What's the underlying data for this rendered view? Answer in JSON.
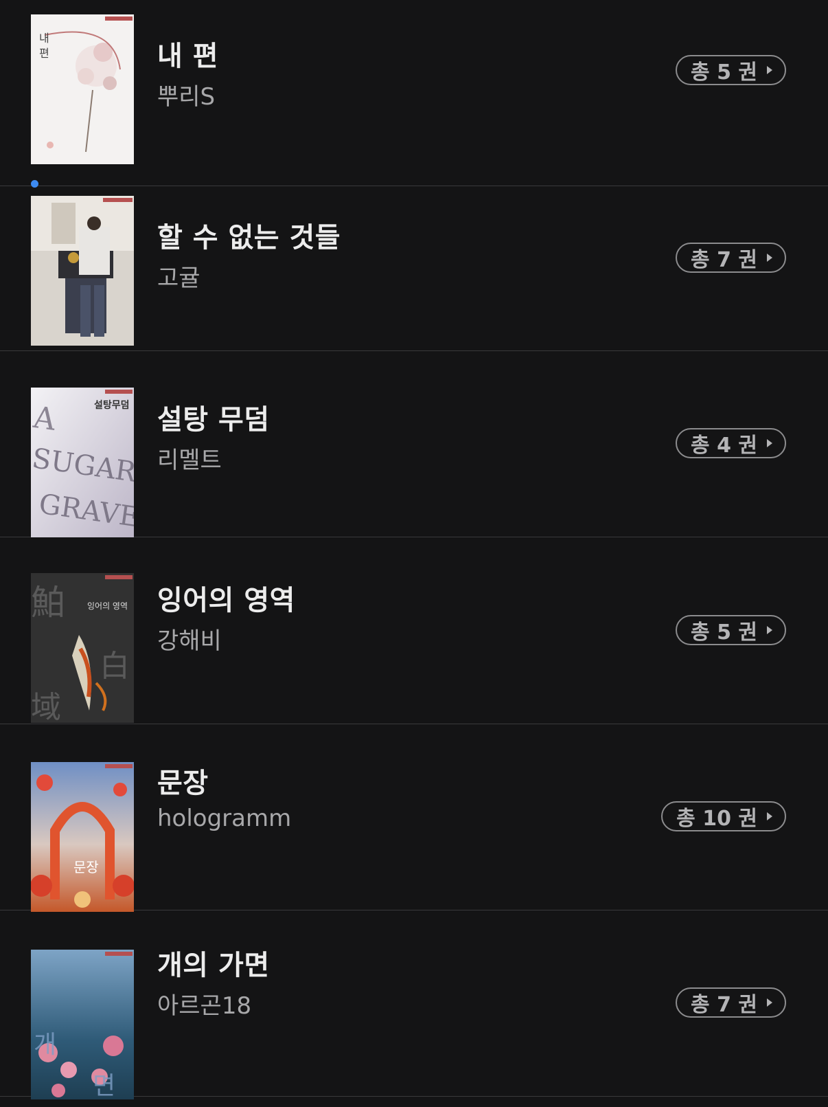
{
  "books": [
    {
      "title": "내 편",
      "author": "뿌리S",
      "volumes": "총 5 권",
      "cover_colors": [
        "#f4f2f1",
        "#e6c9c9",
        "#c07878"
      ],
      "cover_text": "내편",
      "is_new": false
    },
    {
      "title": "할 수 없는 것들",
      "author": "고귤",
      "volumes": "총 7 권",
      "cover_colors": [
        "#d9d4cd",
        "#3a3f52",
        "#7a6a58"
      ],
      "cover_text": "",
      "is_new": true
    },
    {
      "title": "설탕 무덤",
      "author": "리멜트",
      "volumes": "총 4 권",
      "cover_colors": [
        "#ece9f0",
        "#9a94a4",
        "#5e5866"
      ],
      "cover_text": "설탕무덤",
      "is_new": false
    },
    {
      "title": "잉어의 영역",
      "author": "강해비",
      "volumes": "총 5 권",
      "cover_colors": [
        "#2a2a2a",
        "#d8d0bc",
        "#c8501e"
      ],
      "cover_text": "잉어의 영역",
      "is_new": false
    },
    {
      "title": "문장",
      "author": "hologramm",
      "volumes": "총 10 권",
      "cover_colors": [
        "#6f8fc4",
        "#e0542e",
        "#f0c27a"
      ],
      "cover_text": "문장",
      "is_new": false
    },
    {
      "title": "개의 가면",
      "author": "아르곤18",
      "volumes": "총 7 권",
      "cover_colors": [
        "#5f86a8",
        "#2f5b78",
        "#e08aa0"
      ],
      "cover_text": "개의 가면",
      "is_new": false
    }
  ]
}
